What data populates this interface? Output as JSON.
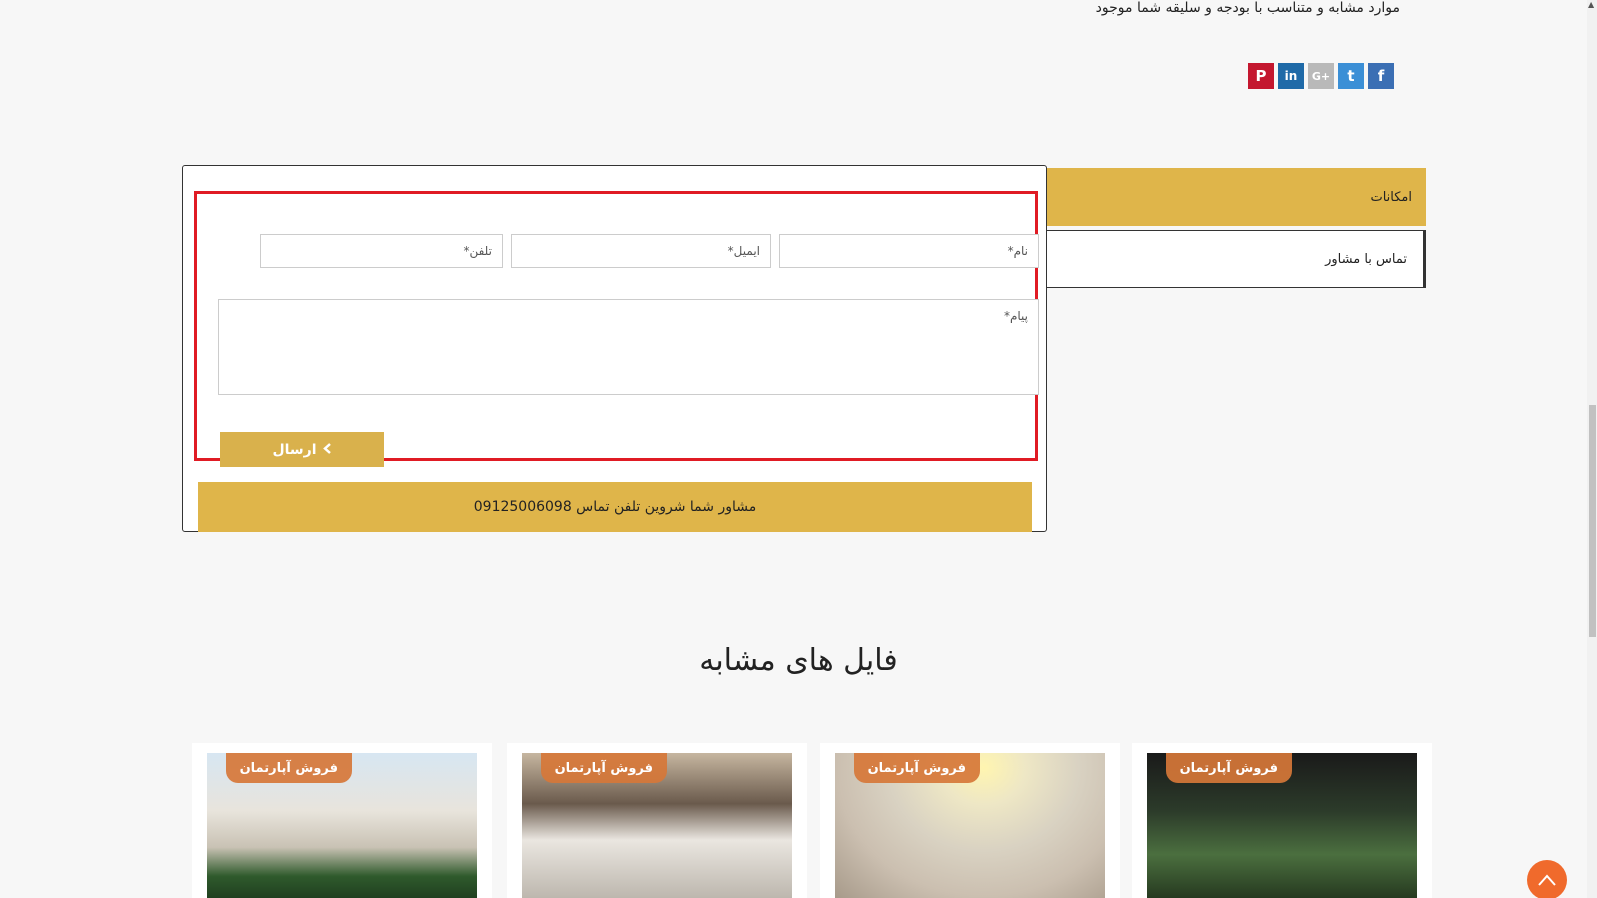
{
  "intro": {
    "text": "موارد مشابه و متناسب با بودجه و سلیقه شما موجود"
  },
  "social": {
    "items": [
      {
        "name": "facebook",
        "glyph": "f"
      },
      {
        "name": "twitter",
        "glyph": "t"
      },
      {
        "name": "google-plus",
        "glyph": "G+"
      },
      {
        "name": "linkedin",
        "glyph": "in"
      },
      {
        "name": "pinterest",
        "glyph": "P"
      }
    ]
  },
  "tabs": {
    "features": "امکانات",
    "contact_advisor": "تماس با مشاور"
  },
  "form": {
    "name_placeholder": "نام*",
    "email_placeholder": "ایمیل*",
    "phone_placeholder": "تلفن*",
    "message_placeholder": "پیام*",
    "submit_label": "ارسال"
  },
  "advisor": {
    "text": "مشاور شما شروین تلفن تماس 09125006098"
  },
  "similar": {
    "title": "فایل های مشابه",
    "cards": [
      {
        "badge": "فروش آپارتمان"
      },
      {
        "badge": "فروش آپارتمان"
      },
      {
        "badge": "فروش آپارتمان"
      },
      {
        "badge": "فروش آپارتمان"
      }
    ]
  },
  "colors": {
    "accent": "#dfb54a",
    "highlight": "#e01b24",
    "scroll_top": "#f06a2c"
  }
}
